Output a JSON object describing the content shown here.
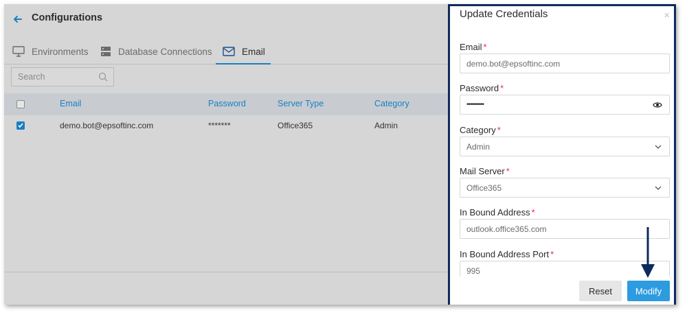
{
  "app": {
    "title": "Configurations",
    "tabs": [
      {
        "label": "Environments",
        "icon": "monitor-icon"
      },
      {
        "label": "Database Connections",
        "icon": "database-icon"
      },
      {
        "label": "Email",
        "icon": "mail-icon",
        "active": true
      }
    ],
    "search": {
      "placeholder": "Search"
    },
    "table": {
      "columns": [
        "Email",
        "Password",
        "Server Type",
        "Category"
      ],
      "rows": [
        {
          "checked": true,
          "email": "demo.bot@epsoftinc.com",
          "password": "*******",
          "server_type": "Office365",
          "category": "Admin"
        }
      ]
    }
  },
  "modal": {
    "title": "Update Credentials",
    "close_label": "×",
    "fields": [
      {
        "label": "Email",
        "required": "*",
        "value": "demo.bot@epsoftinc.com",
        "type": "text"
      },
      {
        "label": "Password",
        "required": "*",
        "value": "••••••••••",
        "type": "password"
      },
      {
        "label": "Category",
        "required": "*",
        "value": "Admin",
        "type": "select"
      },
      {
        "label": "Mail Server",
        "required": "*",
        "value": "Office365",
        "type": "select"
      },
      {
        "label": "In Bound Address",
        "required": "*",
        "value": "outlook.office365.com",
        "type": "text"
      },
      {
        "label": "In Bound Address Port",
        "required": "*",
        "value": "995",
        "type": "text"
      }
    ],
    "buttons": {
      "reset": "Reset",
      "modify": "Modify"
    }
  },
  "colors": {
    "accent": "#1a7fc1",
    "primary_button": "#2d9be0",
    "panel_border": "#0d2a5c",
    "required": "#e0303c"
  }
}
